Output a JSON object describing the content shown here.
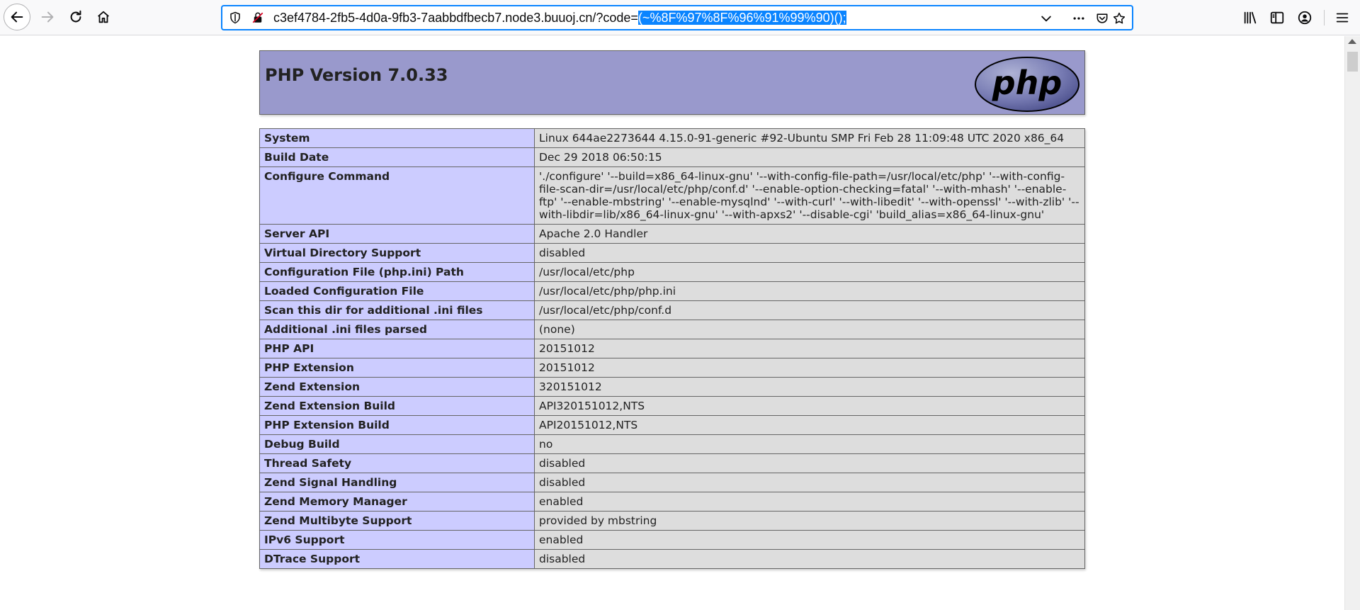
{
  "browser": {
    "url_prefix": "c3ef4784-2fb5-4d0a-9fb3-7aabbdfbecb7.node3.buuoj.cn/?code=",
    "url_selected": "(~%8F%97%8F%96%91%99%90)();"
  },
  "page": {
    "title": "PHP Version 7.0.33",
    "logo_text": "php",
    "rows": [
      {
        "key": "System",
        "value": "Linux 644ae2273644 4.15.0-91-generic #92-Ubuntu SMP Fri Feb 28 11:09:48 UTC 2020 x86_64"
      },
      {
        "key": "Build Date",
        "value": "Dec 29 2018 06:50:15"
      },
      {
        "key": "Configure Command",
        "value": "'./configure' '--build=x86_64-linux-gnu' '--with-config-file-path=/usr/local/etc/php' '--with-config-file-scan-dir=/usr/local/etc/php/conf.d' '--enable-option-checking=fatal' '--with-mhash' '--enable-ftp' '--enable-mbstring' '--enable-mysqlnd' '--with-curl' '--with-libedit' '--with-openssl' '--with-zlib' '--with-libdir=lib/x86_64-linux-gnu' '--with-apxs2' '--disable-cgi' 'build_alias=x86_64-linux-gnu'"
      },
      {
        "key": "Server API",
        "value": "Apache 2.0 Handler"
      },
      {
        "key": "Virtual Directory Support",
        "value": "disabled"
      },
      {
        "key": "Configuration File (php.ini) Path",
        "value": "/usr/local/etc/php"
      },
      {
        "key": "Loaded Configuration File",
        "value": "/usr/local/etc/php/php.ini"
      },
      {
        "key": "Scan this dir for additional .ini files",
        "value": "/usr/local/etc/php/conf.d"
      },
      {
        "key": "Additional .ini files parsed",
        "value": "(none)"
      },
      {
        "key": "PHP API",
        "value": "20151012"
      },
      {
        "key": "PHP Extension",
        "value": "20151012"
      },
      {
        "key": "Zend Extension",
        "value": "320151012"
      },
      {
        "key": "Zend Extension Build",
        "value": "API320151012,NTS"
      },
      {
        "key": "PHP Extension Build",
        "value": "API20151012,NTS"
      },
      {
        "key": "Debug Build",
        "value": "no"
      },
      {
        "key": "Thread Safety",
        "value": "disabled"
      },
      {
        "key": "Zend Signal Handling",
        "value": "disabled"
      },
      {
        "key": "Zend Memory Manager",
        "value": "enabled"
      },
      {
        "key": "Zend Multibyte Support",
        "value": "provided by mbstring"
      },
      {
        "key": "IPv6 Support",
        "value": "enabled"
      },
      {
        "key": "DTrace Support",
        "value": "disabled"
      }
    ]
  },
  "colors": {
    "header_bg": "#9999cc",
    "key_bg": "#ccccff",
    "value_bg": "#dddddd",
    "url_selection": "#0a84ff"
  }
}
